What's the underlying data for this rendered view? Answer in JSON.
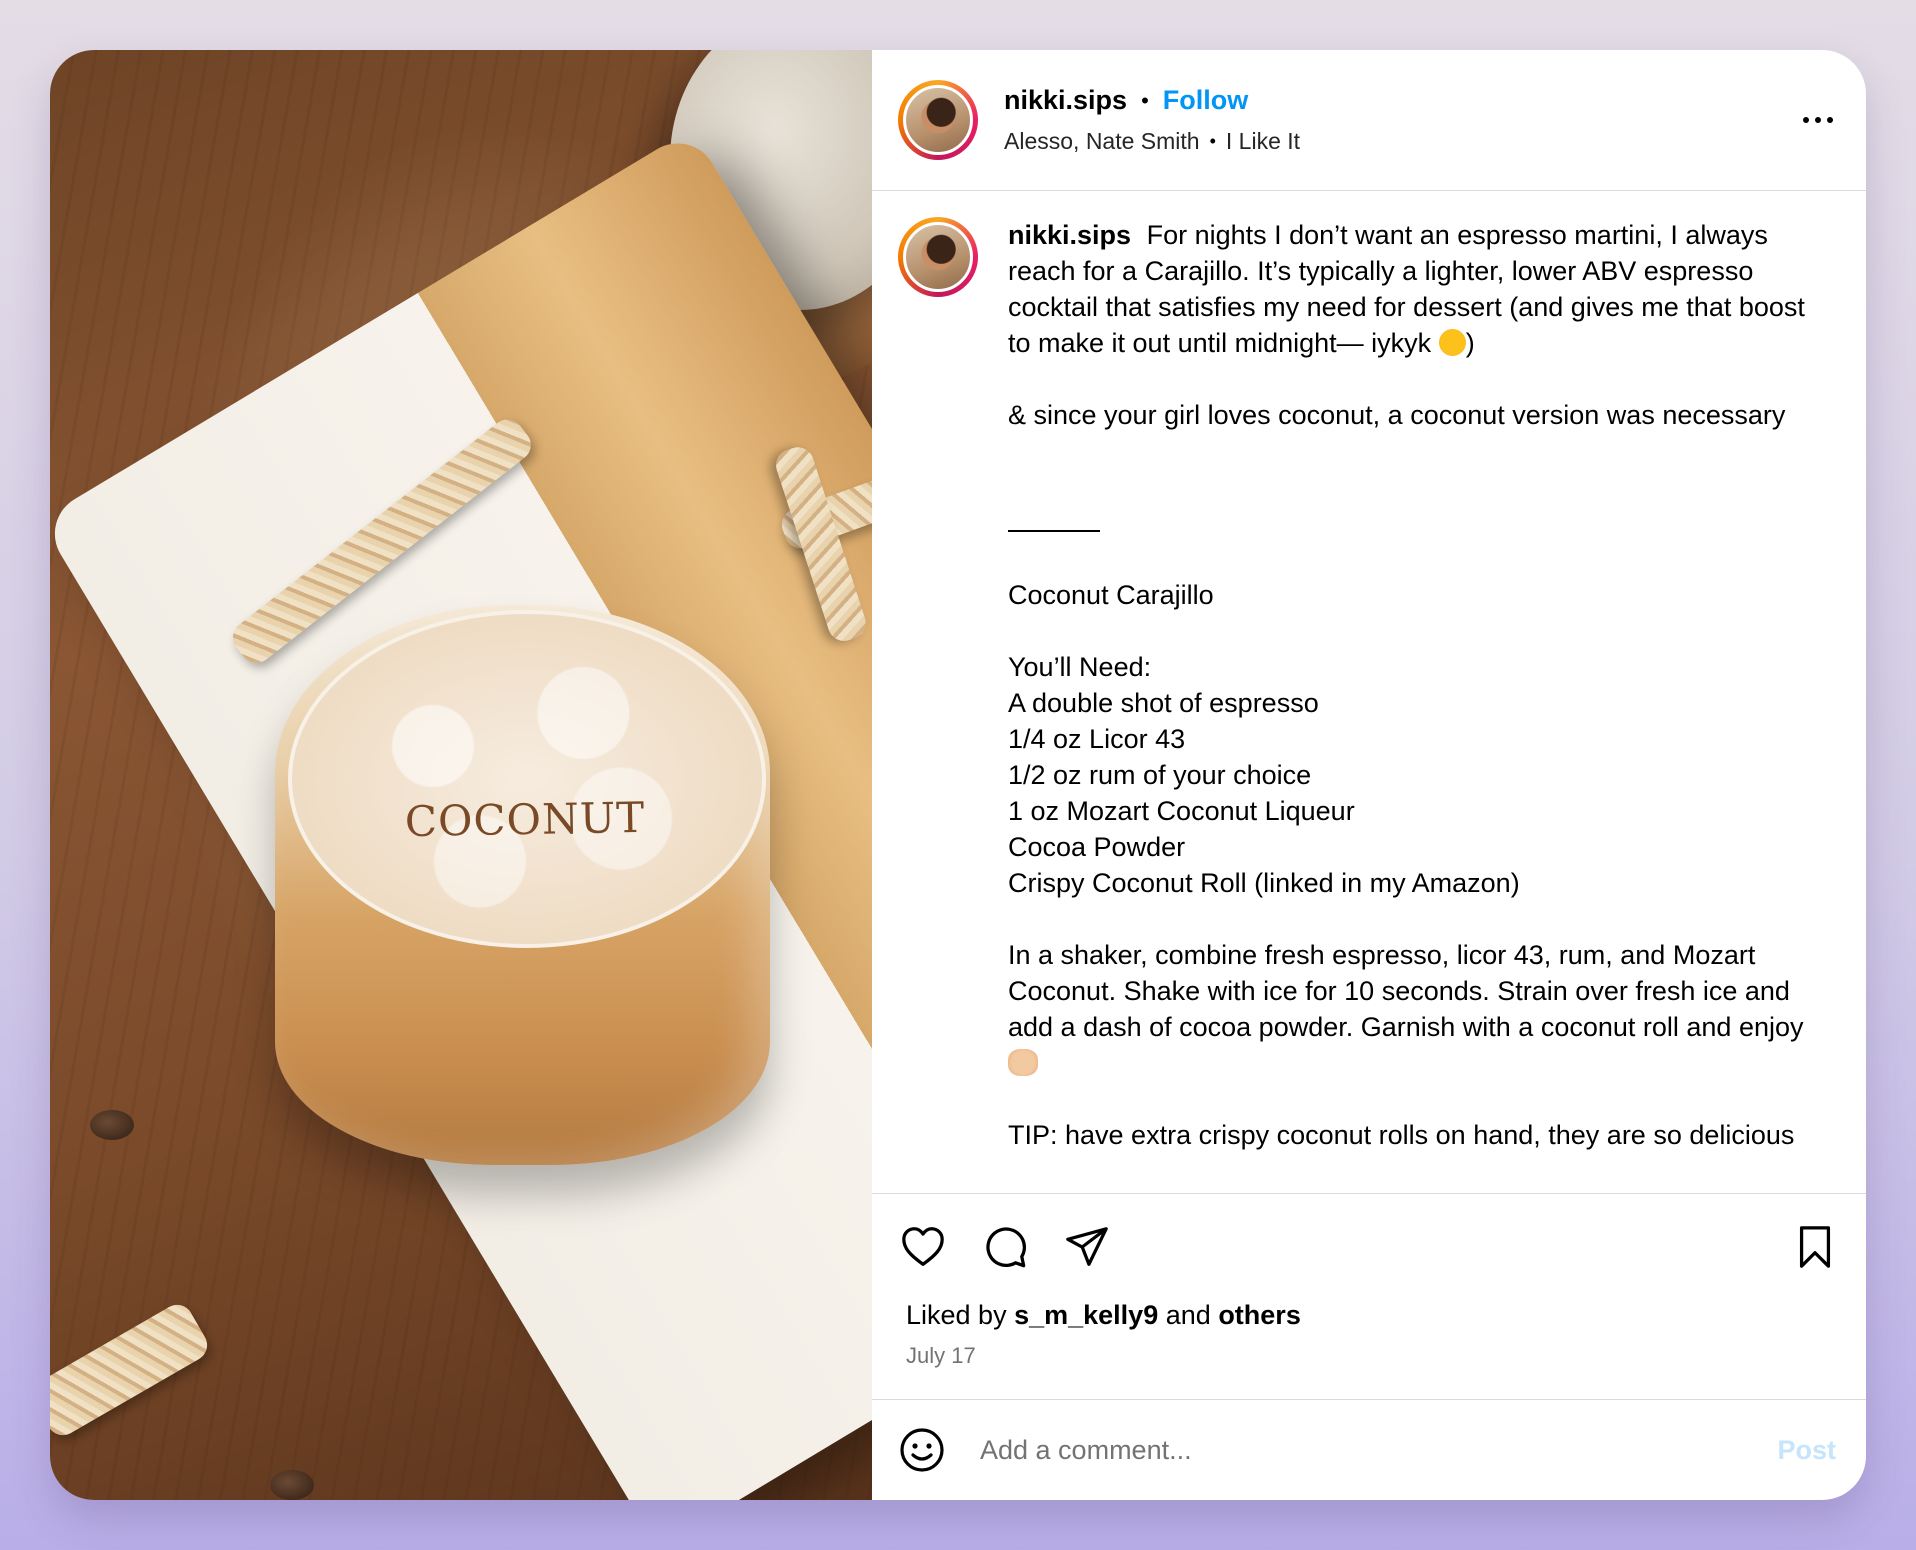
{
  "post": {
    "username": "nikki.sips",
    "separator": "•",
    "follow_label": "Follow",
    "audio_artist": "Alesso, Nate Smith",
    "audio_title": "I Like It"
  },
  "image": {
    "glass_label": "COCONUT"
  },
  "caption": {
    "username": "nikki.sips",
    "intro": "For nights I don’t want an espresso martini, I always reach for a Carajillo. It’s typically a lighter, lower ABV espresso cocktail that satisfies my need for dessert (and gives me that boost to make it out until midnight— iykyk",
    "intro_end": ")",
    "coconut_note": "& since your girl loves coconut, a coconut version was necessary",
    "recipe_title": "Coconut Carajillo",
    "needs_heading": "You’ll Need:",
    "ingredients": [
      "A double shot of espresso",
      "1/4 oz Licor 43",
      "1/2 oz rum of your choice",
      "1 oz Mozart Coconut Liqueur",
      "Cocoa Powder",
      "Crispy Coconut Roll (linked in my Amazon)"
    ],
    "instructions": "In a shaker, combine fresh espresso, licor 43, rum, and Mozart Coconut. Shake with ice for 10 seconds. Strain over fresh ice and add a dash of cocoa powder. Garnish with a coconut roll and enjoy",
    "tip": "TIP: have extra crispy coconut rolls on hand, they are so delicious"
  },
  "likes": {
    "prefix": "Liked by",
    "user": "s_m_kelly9",
    "middle": "and",
    "others": "others"
  },
  "date": "July 17",
  "comment": {
    "placeholder": "Add a comment...",
    "post_label": "Post"
  },
  "icons": {
    "more": "more-horizontal-icon",
    "like": "heart-icon",
    "comment": "comment-bubble-icon",
    "share": "paper-plane-icon",
    "save": "bookmark-icon",
    "emoji": "smiley-icon"
  },
  "colors": {
    "follow": "#0095f6",
    "post_disabled": "#c6e4fb",
    "secondary_text": "#737373",
    "divider": "#dbdbdb"
  }
}
